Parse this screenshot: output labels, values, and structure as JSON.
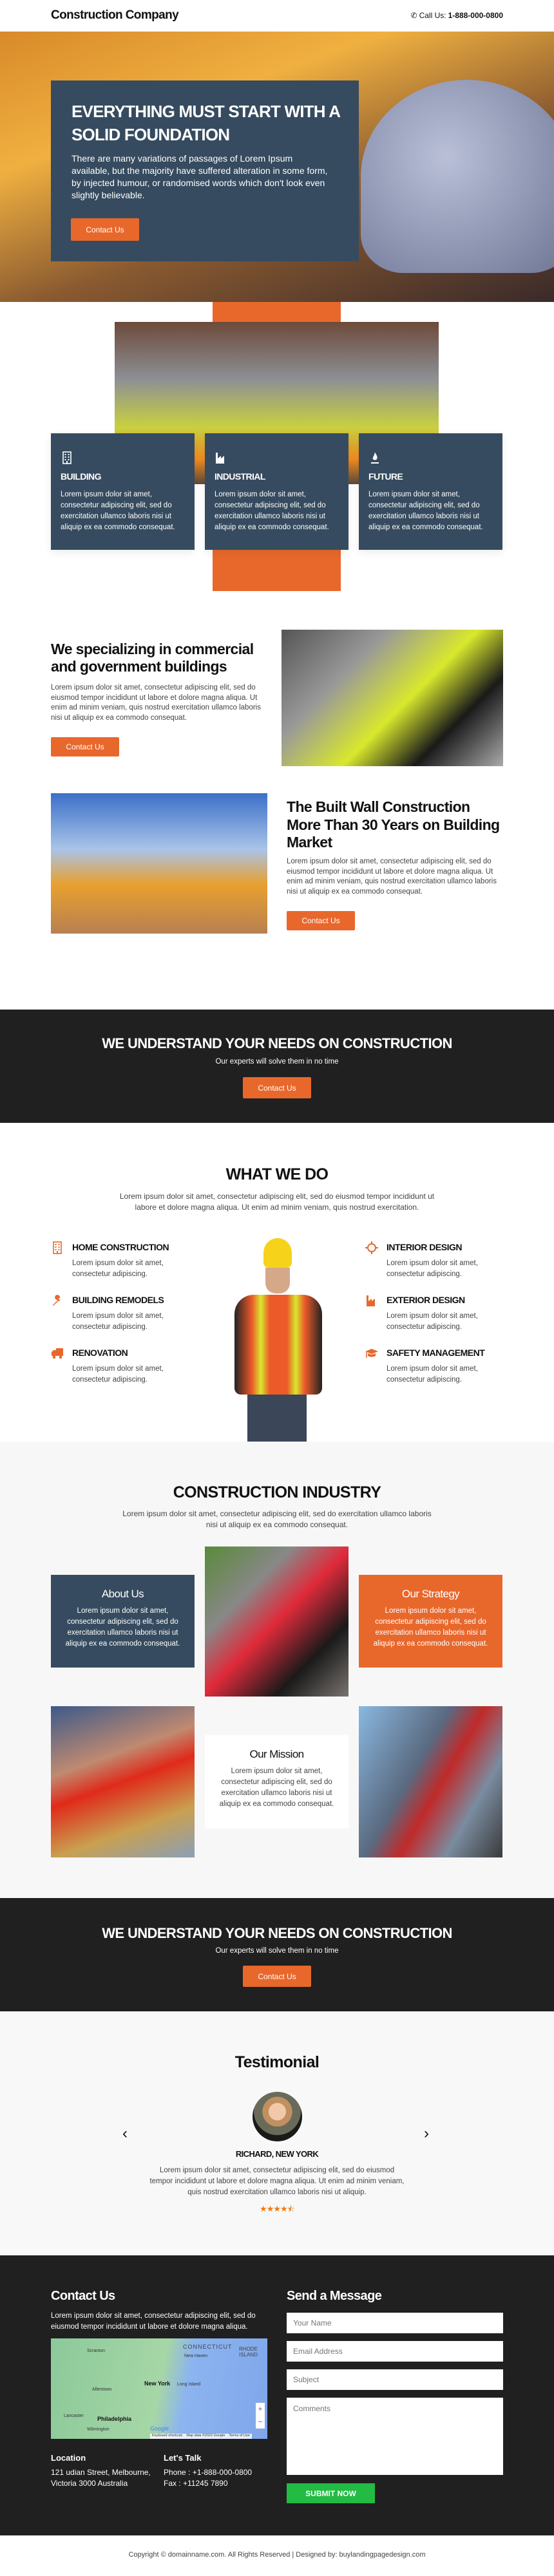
{
  "header": {
    "logo": "Construction Company",
    "call_label": "Call Us:",
    "phone": "1-888-000-0800",
    "phone_icon": "phone-icon"
  },
  "hero": {
    "title": "EVERYTHING MUST START WITH A SOLID FOUNDATION",
    "text": "There are many variations of passages of Lorem Ipsum available, but the majority have suffered alteration in some form, by injected humour, or randomised words which don't look even slightly believable.",
    "cta": "Contact Us"
  },
  "features": [
    {
      "icon": "building-icon",
      "title": "BUILDING",
      "text": "Lorem ipsum dolor sit amet, consectetur adipiscing elit, sed do exercitation ullamco laboris nisi ut aliquip ex ea commodo consequat."
    },
    {
      "icon": "factory-icon",
      "title": "INDUSTRIAL",
      "text": "Lorem ipsum dolor sit amet, consectetur adipiscing elit, sed do exercitation ullamco laboris nisi ut aliquip ex ea commodo consequat."
    },
    {
      "icon": "fire-icon",
      "title": "FUTURE",
      "text": "Lorem ipsum dolor sit amet, consectetur adipiscing elit, sed do exercitation ullamco laboris nisi ut aliquip ex ea commodo consequat."
    }
  ],
  "special": {
    "title": "We specializing in commercial and government buildings",
    "text": "Lorem ipsum dolor sit amet, consectetur adipiscing elit, sed do eiusmod tempor incididunt ut labore et dolore magna aliqua. Ut enim ad minim veniam, quis nostrud exercitation ullamco laboris nisi ut aliquip ex ea commodo consequat.",
    "cta": "Contact Us"
  },
  "built": {
    "title": "The Built Wall Construction More Than 30 Years on Building Market",
    "text": "Lorem ipsum dolor sit amet, consectetur adipiscing elit, sed do eiusmod tempor incididunt ut labore et dolore magna aliqua. Ut enim ad minim veniam, quis nostrud exercitation ullamco laboris nisi ut aliquip ex ea commodo consequat.",
    "cta": "Contact Us"
  },
  "banner": {
    "title": "WE UNDERSTAND YOUR NEEDS ON CONSTRUCTION",
    "subtitle": "Our experts will solve them in no time",
    "cta": "Contact Us"
  },
  "whatwedo": {
    "title": "WHAT WE DO",
    "text": "Lorem ipsum dolor sit amet, consectetur adipiscing elit, sed do eiusmod tempor incididunt ut labore et dolore magna aliqua. Ut enim ad minim veniam, quis nostrud exercitation.",
    "services": [
      {
        "icon": "building-icon",
        "title": "HOME CONSTRUCTION",
        "text": "Lorem ipsum dolor sit amet, consectetur adipiscing."
      },
      {
        "icon": "wrench-icon",
        "title": "BUILDING REMODELS",
        "text": "Lorem ipsum dolor sit amet, consectetur adipiscing."
      },
      {
        "icon": "truck-icon",
        "title": "RENOVATION",
        "text": "Lorem ipsum dolor sit amet, consectetur adipiscing."
      },
      {
        "icon": "crosshair-icon",
        "title": "INTERIOR DESIGN",
        "text": "Lorem ipsum dolor sit amet, consectetur adipiscing."
      },
      {
        "icon": "factory-icon",
        "title": "EXTERIOR DESIGN",
        "text": "Lorem ipsum dolor sit amet, consectetur adipiscing."
      },
      {
        "icon": "graduation-cap-icon",
        "title": "SAFETY MANAGEMENT",
        "text": "Lorem ipsum dolor sit amet, consectetur adipiscing."
      }
    ]
  },
  "industry": {
    "title": "CONSTRUCTION INDUSTRY",
    "text": "Lorem ipsum dolor sit amet, consectetur adipiscing elit, sed do exercitation ullamco laboris nisi ut aliquip ex ea commodo consequat.",
    "about": {
      "title": "About Us",
      "text": "Lorem ipsum dolor sit amet, consectetur adipiscing elit, sed do exercitation ullamco laboris nisi ut aliquip ex ea commodo consequat."
    },
    "strategy": {
      "title": "Our Strategy",
      "text": "Lorem ipsum dolor sit amet, consectetur adipiscing elit, sed do exercitation ullamco laboris nisi ut aliquip ex ea commodo consequat."
    },
    "mission": {
      "title": "Our Mission",
      "text": "Lorem ipsum dolor sit amet, consectetur adipiscing elit, sed do exercitation ullamco laboris nisi ut aliquip ex ea commodo consequat."
    }
  },
  "banner2": {
    "title": "WE UNDERSTAND YOUR NEEDS ON CONSTRUCTION",
    "subtitle": "Our experts will solve them in no time",
    "cta": "Contact Us"
  },
  "testimonial": {
    "title": "Testimonial",
    "name": "RICHARD, NEW YORK",
    "text": "Lorem ipsum dolor sit amet, consectetur adipiscing elit, sed do eiusmod tempor incididunt ut labore et dolore magna aliqua. Ut enim ad minim veniam, quis nostrud exercitation ullamco laboris nisi ut aliquip.",
    "rating": 4.5,
    "rating_max": 5
  },
  "contact": {
    "title": "Contact Us",
    "text": "Lorem ipsum dolor sit amet, consectetur adipiscing elit, sed do eiusmod tempor incididunt ut labore et dolore magna aliqua.",
    "map": {
      "labels": [
        "CONNECTICUT",
        "RHODE ISLAND",
        "Scranton",
        "New Haven",
        "New York",
        "Long Island",
        "Allentown",
        "Philadelphia",
        "Lancaster",
        "Wilmington"
      ],
      "attribution": [
        "Keyboard shortcuts",
        "Map data ©2022 Google",
        "Terms of Use"
      ],
      "logo": "Google"
    },
    "location_title": "Location",
    "address_line1": "121 udian Street, Melbourne,",
    "address_line2": "Victoria 3000 Australia",
    "talk_title": "Let's Talk",
    "phone": "Phone : +1-888-000-0800",
    "fax": "Fax : +11245 7890"
  },
  "form": {
    "title": "Send a Message",
    "name_placeholder": "Your Name",
    "email_placeholder": "Email Address",
    "subject_placeholder": "Subject",
    "comments_placeholder": "Comments",
    "submit": "SUBMIT NOW"
  },
  "footer": {
    "copyright": "Copyright © domainname.com. All Rights Reserved | Designed by: buylandingpagedesign.com"
  },
  "colors": {
    "accent": "#e8682c",
    "navy": "#364b5f",
    "dark": "#202020",
    "submit": "#22bb44"
  }
}
